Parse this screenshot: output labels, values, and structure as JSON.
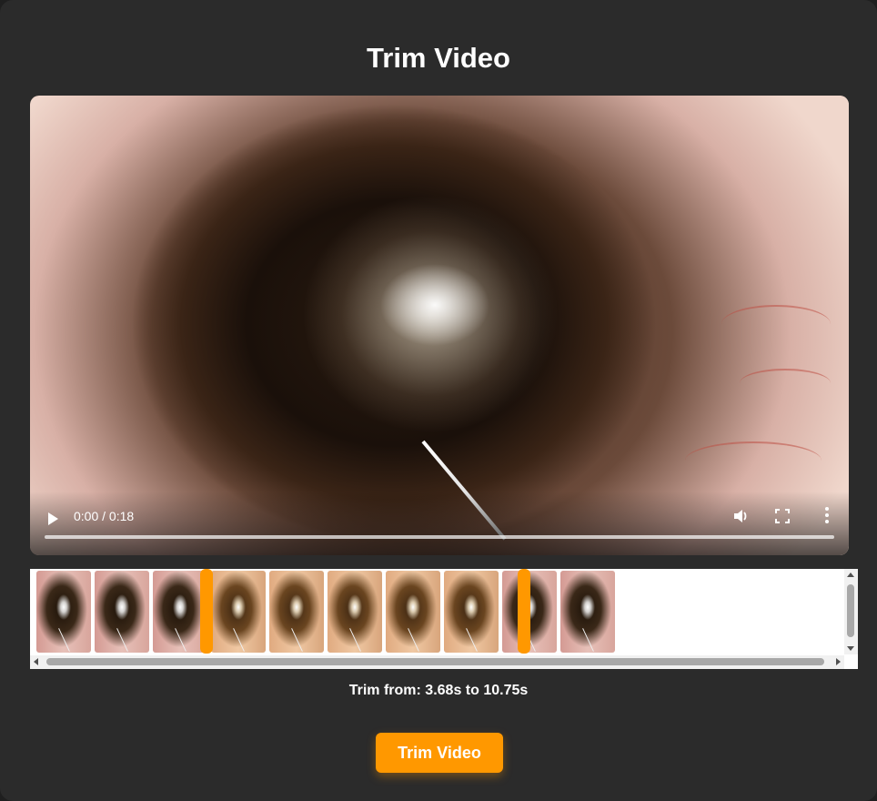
{
  "page": {
    "title": "Trim Video"
  },
  "player": {
    "time_display": "0:00 / 0:18",
    "progress": 0
  },
  "timeline": {
    "thumbnail_count": 10,
    "trim_start_seconds": 3.68,
    "trim_end_seconds": 10.75
  },
  "trim_info": {
    "text": "Trim from: 3.68s to 10.75s"
  },
  "actions": {
    "trim_button_label": "Trim Video"
  },
  "colors": {
    "accent": "#ff9800",
    "panel_background": "#2b2b2b"
  },
  "icons": {
    "play": "play-icon",
    "volume": "volume-icon",
    "fullscreen": "fullscreen-icon",
    "more": "more-vertical-icon"
  }
}
